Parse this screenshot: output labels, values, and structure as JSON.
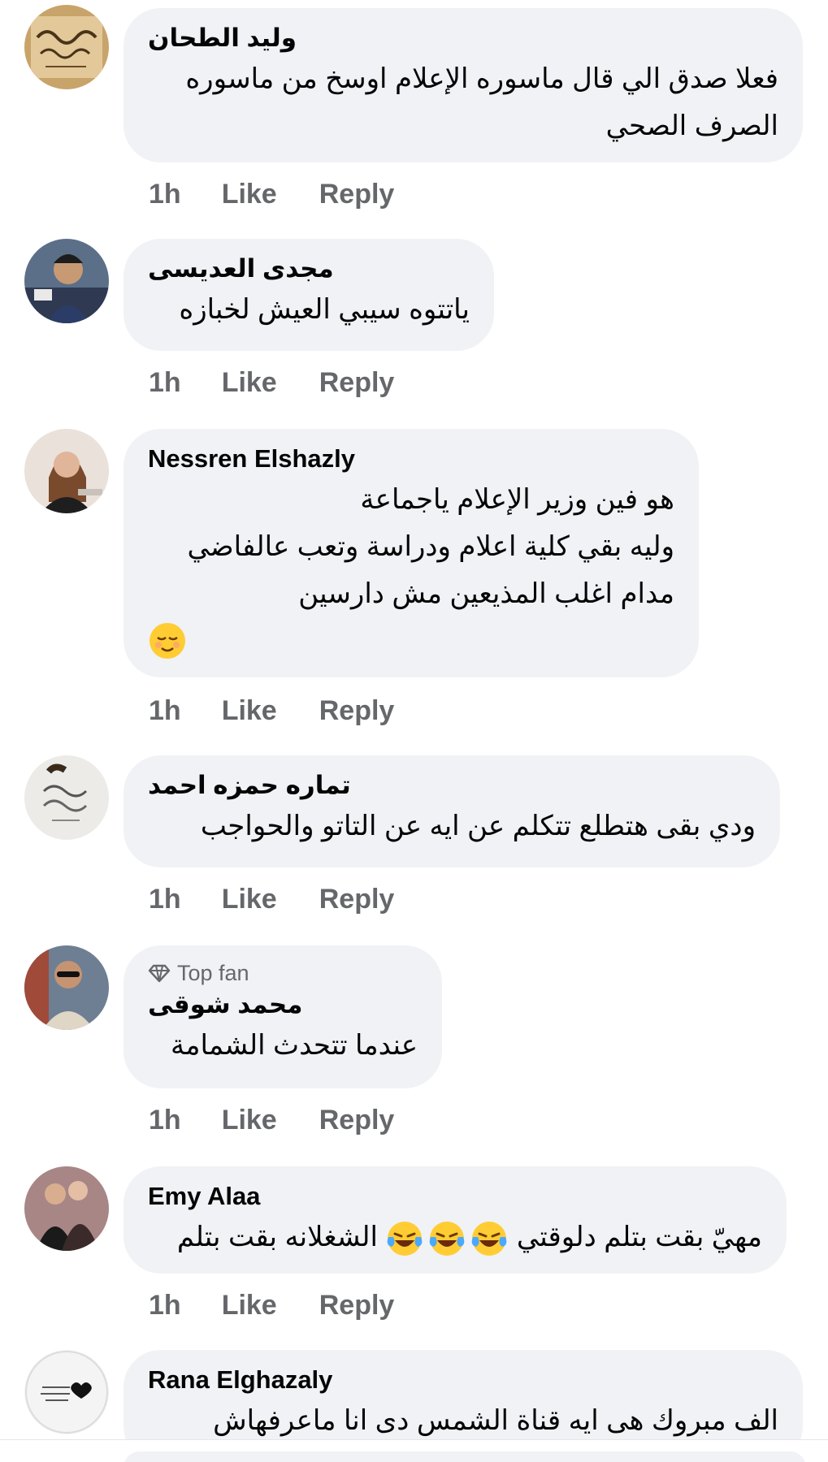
{
  "colors": {
    "bubble": "#f0f2f5",
    "meta_text": "#65676b",
    "name_text": "#050505"
  },
  "comments": [
    {
      "author": "وليد الطحان",
      "lines": [
        "فعلا صدق الي قال ماسوره الإعلام اوسخ من ماسوره",
        "الصرف الصحي"
      ],
      "time": "1h",
      "like": "Like",
      "reply": "Reply",
      "avatar": "calligraphy-avatar"
    },
    {
      "author": "مجدى العديسى",
      "lines": [
        "ياتتوه سيبي العيش لخبازه"
      ],
      "time": "1h",
      "like": "Like",
      "reply": "Reply",
      "avatar": "man-portrait-avatar"
    },
    {
      "author": "Nessren Elshazly",
      "lines": [
        "هو فين وزير الإعلام ياجماعة",
        "وليه بقي كلية اعلام ودراسة وتعب عالفاضي",
        "مدام اغلب المذيعين مش دارسين"
      ],
      "emoji": "relieved-face-emoji",
      "time": "1h",
      "like": "Like",
      "reply": "Reply",
      "avatar": "woman-portrait-avatar"
    },
    {
      "author": "تماره حمزه احمد",
      "lines": [
        "ودي بقى هتطلع تتكلم عن ايه عن التاتو والحواجب"
      ],
      "time": "1h",
      "like": "Like",
      "reply": "Reply",
      "avatar": "arabic-text-avatar"
    },
    {
      "badge": "Top fan",
      "author": "محمد شوقى",
      "lines": [
        "عندما تتحدث الشمامة"
      ],
      "time": "1h",
      "like": "Like",
      "reply": "Reply",
      "avatar": "man-sunglasses-avatar"
    },
    {
      "author": "Emy Alaa",
      "line_before": "مهيّ بقت بتلم دلوقتي ",
      "line_after": "الشغلانه بقت بتلم",
      "emojis": [
        "laughing-tears-emoji",
        "laughing-tears-emoji",
        "laughing-tears-emoji"
      ],
      "time": "1h",
      "like": "Like",
      "reply": "Reply",
      "avatar": "couple-avatar"
    },
    {
      "author": "Rana Elghazaly",
      "lines": [
        "الف مبروك هى ايه قناة الشمس دى انا ماعرفهاش"
      ],
      "avatar": "heart-text-avatar"
    }
  ]
}
